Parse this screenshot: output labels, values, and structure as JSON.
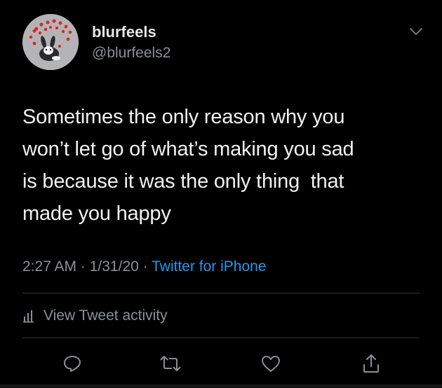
{
  "user": {
    "display_name": "blurfeels",
    "handle": "@blurfeels2",
    "avatar_icon": "hearts-and-bunny-avatar"
  },
  "tweet": {
    "text": "Sometimes the only reason why you\nwon’t let go of what’s making you sad\nis because it was the only thing  that\nmade you happy",
    "time": "2:27 AM",
    "date": "1/31/20",
    "separator": "·",
    "source": "Twitter for iPhone"
  },
  "activity": {
    "label": "View Tweet activity",
    "icon": "activity-bars-icon"
  },
  "actions": [
    {
      "name": "reply",
      "icon": "reply-icon"
    },
    {
      "name": "retweet",
      "icon": "retweet-icon"
    },
    {
      "name": "like",
      "icon": "heart-icon"
    },
    {
      "name": "share",
      "icon": "share-icon"
    }
  ],
  "colors": {
    "background": "#000000",
    "text": "#f2f2f2",
    "secondary": "#8b8f94",
    "link": "#1d9bf0",
    "divider": "#2f3336",
    "heart_red": "#e0242b"
  }
}
